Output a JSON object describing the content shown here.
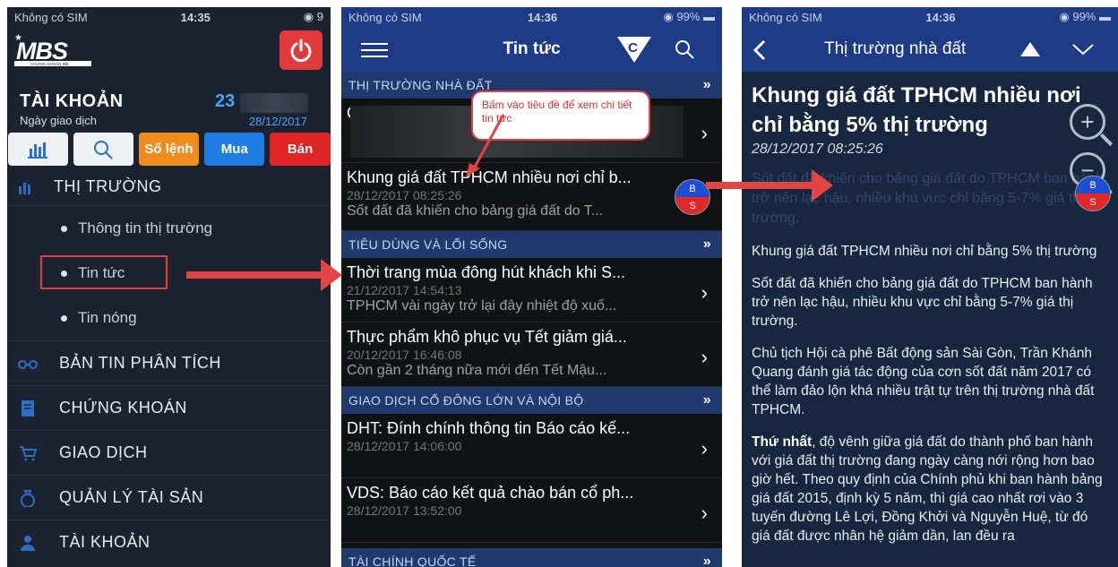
{
  "status": {
    "carrier": "Không có SIM",
    "battery_1": "9",
    "battery": "99%",
    "time_1": "14:35",
    "time_2": "14:36",
    "time_3": "14:36"
  },
  "left_phone": {
    "account_title": "TÀI KHOẢN",
    "account_number": "23",
    "trade_date_label": "Ngày giao dịch",
    "trade_date": "28/12/2017",
    "actions": {
      "order_book": "Sổ lệnh",
      "buy": "Mua",
      "sell": "Bán"
    },
    "menu": {
      "market": "THỊ TRƯỜNG",
      "market_info": "Thông tin thị trường",
      "news": "Tin tức",
      "hot_news": "Tin nóng",
      "analysis": "BẢN TIN PHÂN TÍCH",
      "securities": "CHỨNG KHOÁN",
      "trading": "GIAO DỊCH",
      "asset_mgmt": "QUẢN LÝ TÀI SẢN",
      "account": "TÀI KHOẢN"
    },
    "logo_text": "MBS",
    "logo_sub": "CHỨNG KHOÁN MB"
  },
  "middle_phone": {
    "title": "Tin tức",
    "callout": "Bấm vào tiêu đề để xem chi tiết tin tức",
    "sections": {
      "real_estate": "THỊ TRƯỜNG NHÀ ĐẤT",
      "consumer": "TIÊU DÙNG VÀ LỐI SỐNG",
      "insider": "GIAO DỊCH CỔ ĐÔNG LỚN VÀ NỘI BỘ",
      "international": "TÀI CHÍNH QUỐC TẾ"
    },
    "news": [
      {
        "headline": "Khung giá đất TPHCM nhiều nơi chỉ b...",
        "time": "28/12/2017 08:25:26",
        "summary": "Sốt đất đã khiến cho bảng giá đất do T..."
      },
      {
        "headline": "Thời trang mùa đông hút khách khi S...",
        "time": "21/12/2017 14:54:13",
        "summary": "TPHCM vài ngày trở lại đây nhiệt độ xuố..."
      },
      {
        "headline": "Thực phẩm khô phục vụ Tết giảm giá...",
        "time": "20/12/2017 16:46:08",
        "summary": "Còn gần 2 tháng nữa mới đến Tết Mậu..."
      },
      {
        "headline": "DHT: Đính chính thông tin Báo cáo kế...",
        "time": "28/12/2017 14:06:00",
        "summary": ""
      },
      {
        "headline": "VDS: Báo cáo kết quả chào bán cổ ph...",
        "time": "28/12/2017 13:52:00",
        "summary": ""
      }
    ],
    "first_item_partial": "C"
  },
  "right_phone": {
    "title": "Thị trường nhà đất",
    "article_title": "Khung giá đất TPHCM nhiều nơi chỉ bằng 5% thị trường",
    "article_time": "28/12/2017 08:25:26",
    "faded_lead": "Sốt đất đã khiến cho bảng giá đất do TPHCM ban hành trở nên lạc hậu, nhiều khu vực chỉ bằng 5-7% giá thị trường.",
    "p1": "Khung giá đất TPHCM nhiều nơi chỉ bằng 5% thị trường",
    "p2": "Sốt đất đã khiến cho bảng giá đất do TPHCM ban hành trở nên lạc hậu, nhiều khu vực chỉ bằng 5-7% giá thị trường.",
    "p3": "Chủ tịch Hội cà phê Bất động sản Sài Gòn, Trần Khánh Quang đánh giá tác động của cơn sốt đất năm 2017 có thể làm đảo lộn khá nhiều trật tự trên thị trường nhà đất TPHCM.",
    "p4_bold": "Thứ nhất",
    "p4": ", độ vênh giữa giá đất do thành phố ban hành với giá đất thị trường đang ngày càng nới rộng hơn bao giờ hết. Theo quy định của Chính phủ khi ban hành bảng giá đất 2015, định kỳ 5 năm, thì giá cao nhất rơi vào 3 tuyến đường Lê Lợi, Đồng Khởi và Nguyễn Huệ, từ đó giá đất được nhân hệ giảm dần, lan đều ra"
  },
  "bs_badge": {
    "buy": "B",
    "sell": "S"
  },
  "colors": {
    "nav_blue": "#1d3b86",
    "section_blue": "#203a70",
    "accent_red": "#e34545",
    "sell_red": "#e12424",
    "buy_blue": "#1e7de0",
    "order_orange": "#f08b1e"
  }
}
